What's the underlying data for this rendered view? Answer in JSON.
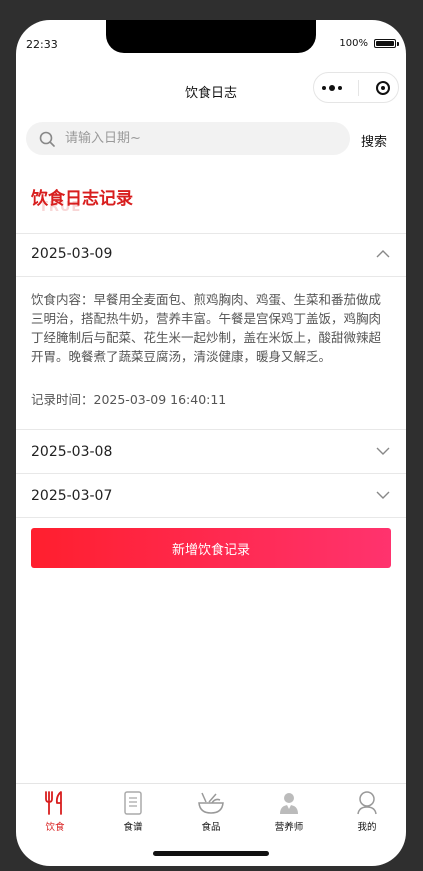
{
  "status": {
    "time": "22:33",
    "battery": "100%"
  },
  "nav": {
    "title": "饮食日志"
  },
  "search": {
    "placeholder": "请输入日期~",
    "button": "搜索"
  },
  "section": {
    "title": "饮食日志记录",
    "watermark": "TRUE"
  },
  "entries": [
    {
      "date": "2025-03-09",
      "expanded": true,
      "content": "饮食内容：早餐用全麦面包、煎鸡胸肉、鸡蛋、生菜和番茄做成三明治，搭配热牛奶，营养丰富。午餐是宫保鸡丁盖饭，鸡胸肉丁经腌制后与配菜、花生米一起炒制，盖在米饭上，酸甜微辣超开胃。晚餐煮了蔬菜豆腐汤，清淡健康，暖身又解乏。",
      "record_time": "记录时间：2025-03-09 16:40:11"
    },
    {
      "date": "2025-03-08",
      "expanded": false
    },
    {
      "date": "2025-03-07",
      "expanded": false
    }
  ],
  "add_button": "新增饮食记录",
  "tabs": [
    {
      "label": "饮食",
      "icon": "fork-knife-icon",
      "active": true
    },
    {
      "label": "食谱",
      "icon": "recipe-book-icon",
      "active": false
    },
    {
      "label": "食品",
      "icon": "food-bowl-icon",
      "active": false
    },
    {
      "label": "营养师",
      "icon": "nutritionist-icon",
      "active": false
    },
    {
      "label": "我的",
      "icon": "user-icon",
      "active": false
    }
  ],
  "colors": {
    "accent": "#d81e1e",
    "button_start": "#ff1f2e",
    "button_end": "#ff336e"
  }
}
